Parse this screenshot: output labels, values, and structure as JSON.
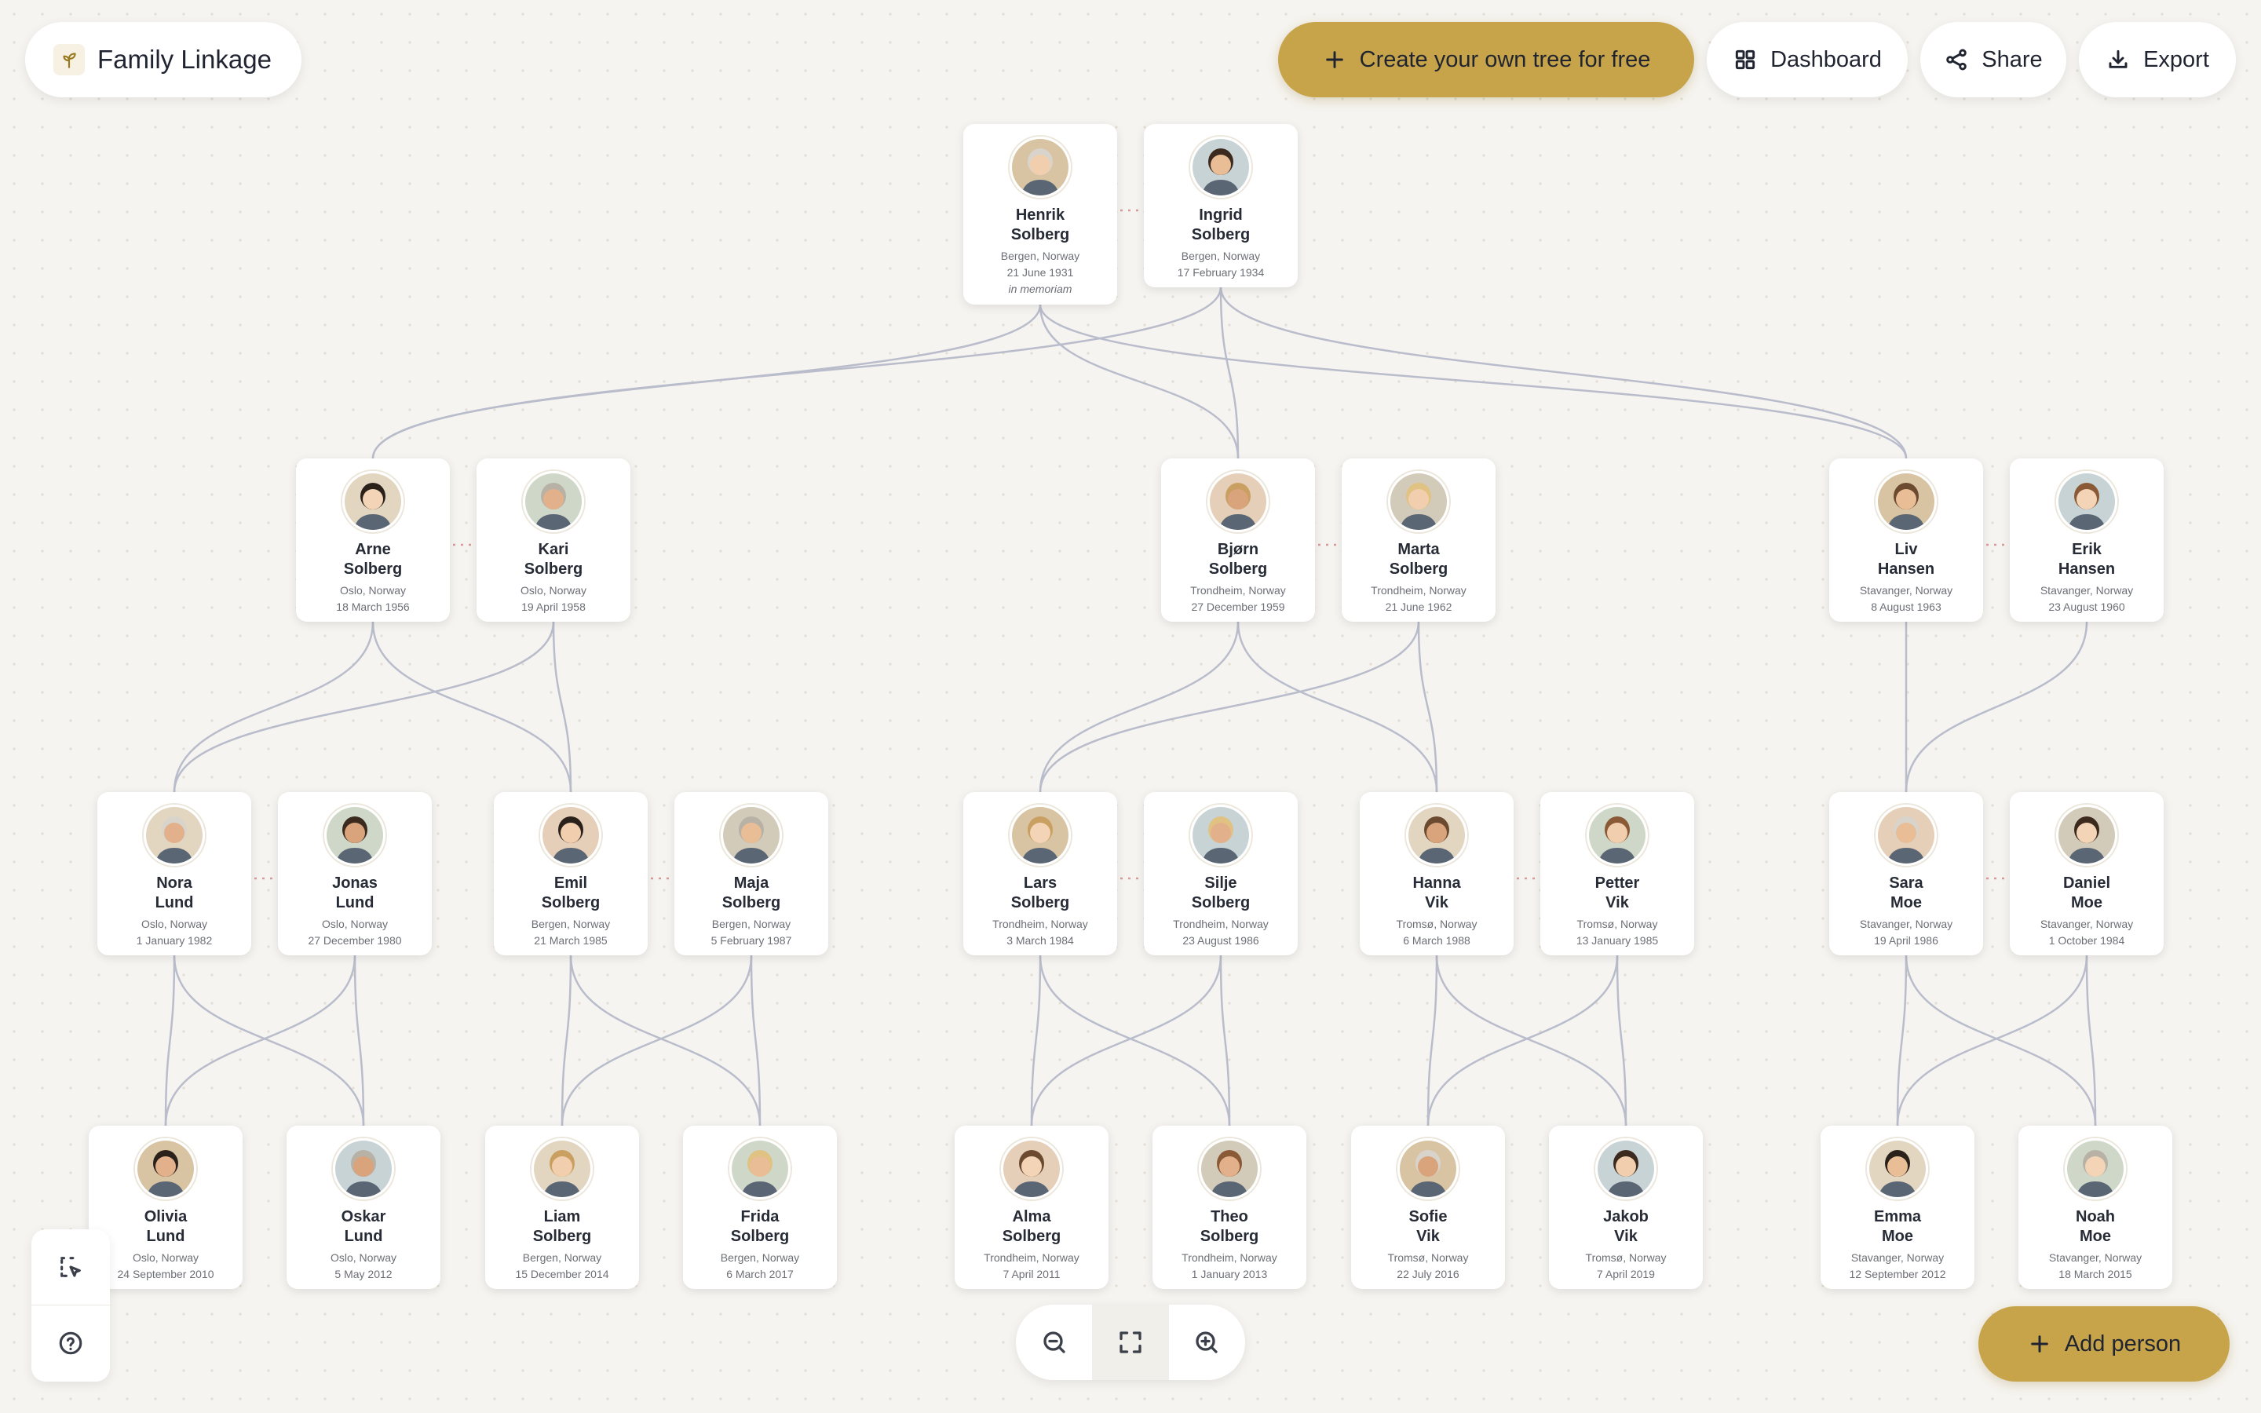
{
  "brand": {
    "name": "Family Linkage"
  },
  "toolbar": {
    "create_label": "Create your own tree for free",
    "dashboard_label": "Dashboard",
    "share_label": "Share",
    "export_label": "Export"
  },
  "actions": {
    "add_person_label": "Add person"
  },
  "colors": {
    "accent": "#c7a44a",
    "background": "#f6f4f0",
    "edge": "#b9bccb",
    "spouse_link": "#d99a9a"
  },
  "icons": {
    "brand": "sprout-icon",
    "create": "plus-icon",
    "dashboard": "grid-icon",
    "share": "share-icon",
    "export": "download-icon",
    "select": "select-area-icon",
    "help": "help-icon",
    "zoom_out": "zoom-out-icon",
    "fit": "fit-screen-icon",
    "zoom_in": "zoom-in-icon",
    "add": "plus-icon"
  },
  "people": [
    {
      "id": "henrik",
      "first": "Henrik",
      "last": "Solberg",
      "place": "Bergen, Norway",
      "date": "21 June 1931",
      "note": "in memoriam"
    },
    {
      "id": "ingrid",
      "first": "Ingrid",
      "last": "Solberg",
      "place": "Bergen, Norway",
      "date": "17 February 1934"
    },
    {
      "id": "arne",
      "first": "Arne",
      "last": "Solberg",
      "place": "Oslo, Norway",
      "date": "18 March 1956"
    },
    {
      "id": "kari",
      "first": "Kari",
      "last": "Solberg",
      "place": "Oslo, Norway",
      "date": "19 April 1958"
    },
    {
      "id": "bjorn",
      "first": "Bjørn",
      "last": "Solberg",
      "place": "Trondheim, Norway",
      "date": "27 December 1959"
    },
    {
      "id": "marta",
      "first": "Marta",
      "last": "Solberg",
      "place": "Trondheim, Norway",
      "date": "21 June 1962"
    },
    {
      "id": "liv",
      "first": "Liv",
      "last": "Hansen",
      "place": "Stavanger, Norway",
      "date": "8 August 1963"
    },
    {
      "id": "erik",
      "first": "Erik",
      "last": "Hansen",
      "place": "Stavanger, Norway",
      "date": "23 August 1960"
    },
    {
      "id": "nora",
      "first": "Nora",
      "last": "Lund",
      "place": "Oslo, Norway",
      "date": "1 January 1982"
    },
    {
      "id": "jonas",
      "first": "Jonas",
      "last": "Lund",
      "place": "Oslo, Norway",
      "date": "27 December 1980"
    },
    {
      "id": "emil",
      "first": "Emil",
      "last": "Solberg",
      "place": "Bergen, Norway",
      "date": "21 March 1985"
    },
    {
      "id": "maja",
      "first": "Maja",
      "last": "Solberg",
      "place": "Bergen, Norway",
      "date": "5 February 1987"
    },
    {
      "id": "lars",
      "first": "Lars",
      "last": "Solberg",
      "place": "Trondheim, Norway",
      "date": "3 March 1984"
    },
    {
      "id": "silje",
      "first": "Silje",
      "last": "Solberg",
      "place": "Trondheim, Norway",
      "date": "23 August 1986"
    },
    {
      "id": "hanna",
      "first": "Hanna",
      "last": "Vik",
      "place": "Tromsø, Norway",
      "date": "6 March 1988"
    },
    {
      "id": "petter",
      "first": "Petter",
      "last": "Vik",
      "place": "Tromsø, Norway",
      "date": "13 January 1985"
    },
    {
      "id": "sara",
      "first": "Sara",
      "last": "Moe",
      "place": "Stavanger, Norway",
      "date": "19 April 1986"
    },
    {
      "id": "daniel",
      "first": "Daniel",
      "last": "Moe",
      "place": "Stavanger, Norway",
      "date": "1 October 1984"
    },
    {
      "id": "olivia",
      "first": "Olivia",
      "last": "Lund",
      "place": "Oslo, Norway",
      "date": "24 September 2010"
    },
    {
      "id": "oskar",
      "first": "Oskar",
      "last": "Lund",
      "place": "Oslo, Norway",
      "date": "5 May 2012"
    },
    {
      "id": "liam",
      "first": "Liam",
      "last": "Solberg",
      "place": "Bergen, Norway",
      "date": "15 December 2014"
    },
    {
      "id": "frida",
      "first": "Frida",
      "last": "Solberg",
      "place": "Bergen, Norway",
      "date": "6 March 2017"
    },
    {
      "id": "alma",
      "first": "Alma",
      "last": "Solberg",
      "place": "Trondheim, Norway",
      "date": "7 April 2011"
    },
    {
      "id": "theo",
      "first": "Theo",
      "last": "Solberg",
      "place": "Trondheim, Norway",
      "date": "1 January 2013"
    },
    {
      "id": "sofie",
      "first": "Sofie",
      "last": "Vik",
      "place": "Tromsø, Norway",
      "date": "22 July 2016"
    },
    {
      "id": "jakob",
      "first": "Jakob",
      "last": "Vik",
      "place": "Tromsø, Norway",
      "date": "7 April 2019"
    },
    {
      "id": "emma",
      "first": "Emma",
      "last": "Moe",
      "place": "Stavanger, Norway",
      "date": "12 September 2012"
    },
    {
      "id": "noah",
      "first": "Noah",
      "last": "Moe",
      "place": "Stavanger, Norway",
      "date": "18 March 2015"
    }
  ],
  "couples": [
    [
      "henrik",
      "ingrid"
    ],
    [
      "arne",
      "kari"
    ],
    [
      "bjorn",
      "marta"
    ],
    [
      "liv",
      "erik"
    ],
    [
      "nora",
      "jonas"
    ],
    [
      "emil",
      "maja"
    ],
    [
      "lars",
      "silje"
    ],
    [
      "hanna",
      "petter"
    ],
    [
      "sara",
      "daniel"
    ]
  ],
  "children": [
    {
      "parents": [
        "henrik",
        "ingrid"
      ],
      "kids": [
        "arne",
        "bjorn",
        "liv"
      ]
    },
    {
      "parents": [
        "arne",
        "kari"
      ],
      "kids": [
        "nora",
        "emil"
      ]
    },
    {
      "parents": [
        "bjorn",
        "marta"
      ],
      "kids": [
        "lars",
        "hanna"
      ]
    },
    {
      "parents": [
        "liv",
        "erik"
      ],
      "kids": [
        "sara"
      ]
    },
    {
      "parents": [
        "nora",
        "jonas"
      ],
      "kids": [
        "olivia",
        "oskar"
      ]
    },
    {
      "parents": [
        "emil",
        "maja"
      ],
      "kids": [
        "liam",
        "frida"
      ]
    },
    {
      "parents": [
        "lars",
        "silje"
      ],
      "kids": [
        "alma",
        "theo"
      ]
    },
    {
      "parents": [
        "hanna",
        "petter"
      ],
      "kids": [
        "sofie",
        "jakob"
      ]
    },
    {
      "parents": [
        "sara",
        "daniel"
      ],
      "kids": [
        "emma",
        "noah"
      ]
    }
  ]
}
